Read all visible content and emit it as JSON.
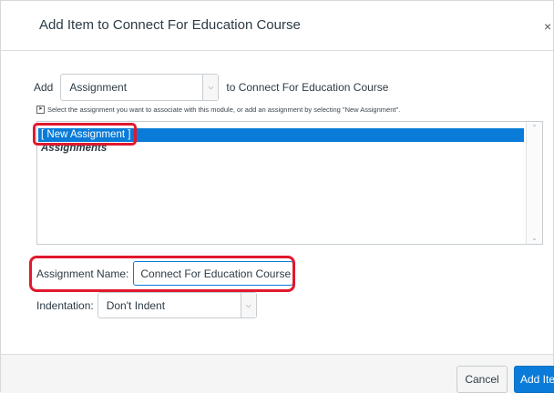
{
  "dialog": {
    "title": "Add Item to Connect For Education Course",
    "close_glyph": "×"
  },
  "add_row": {
    "label": "Add",
    "type_select_value": "Assignment",
    "to_text": "to Connect For Education Course"
  },
  "hint": {
    "icon": "info-icon",
    "text": "Select the assignment you want to associate with this module, or add an assignment by selecting \"New Assignment\"."
  },
  "list": {
    "selected_item": "[ New Assignment ]",
    "group_label": "Assignments"
  },
  "name_field": {
    "label": "Assignment Name:",
    "value": "Connect For Education Course"
  },
  "indentation": {
    "label": "Indentation:",
    "value": "Don't Indent"
  },
  "footer": {
    "cancel_label": "Cancel",
    "add_label": "Add Item"
  },
  "colors": {
    "accent": "#0a7bd8",
    "highlight": "#e0192d"
  }
}
